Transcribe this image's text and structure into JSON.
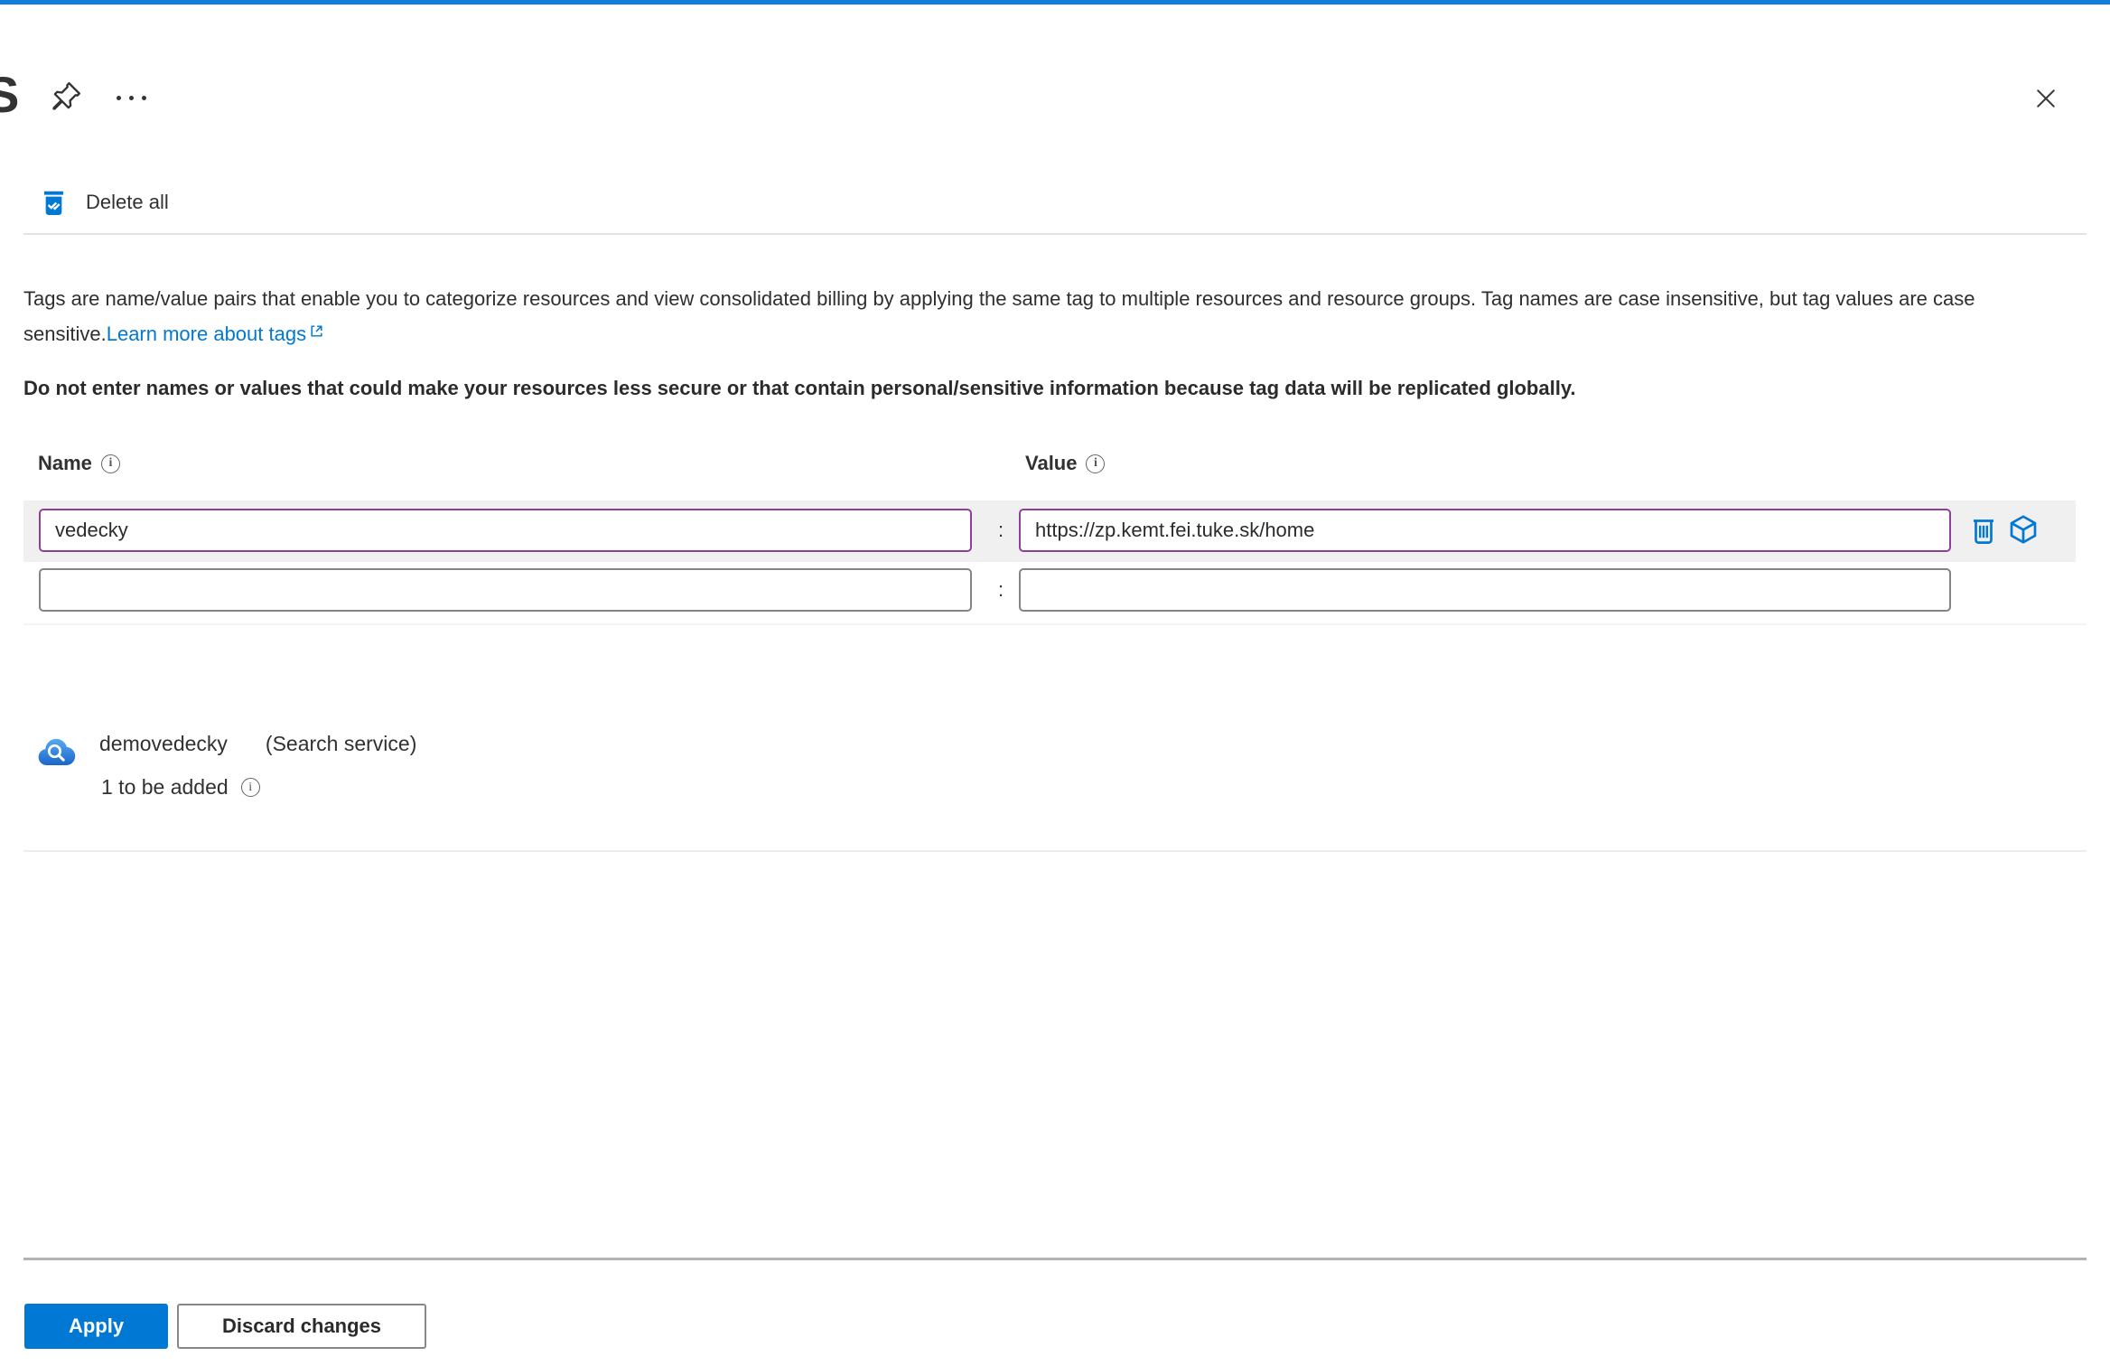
{
  "header": {
    "title_partial": "S",
    "separator_colon": ":"
  },
  "toolbar": {
    "delete_all_label": "Delete all"
  },
  "description": {
    "text": "Tags are name/value pairs that enable you to categorize resources and view consolidated billing by applying the same tag to multiple resources and resource groups. Tag names are case insensitive, but tag values are case sensitive.",
    "link_label": "Learn more about tags",
    "warning": "Do not enter names or values that could make your resources less secure or that contain personal/sensitive information because tag data will be replicated globally."
  },
  "tags_table": {
    "name_header": "Name",
    "value_header": "Value",
    "rows": [
      {
        "name": "vedecky",
        "value": "https://zp.kemt.fei.tuke.sk/home",
        "modified": true
      },
      {
        "name": "",
        "value": "",
        "modified": false
      }
    ]
  },
  "resource": {
    "name": "demovedecky",
    "type": "(Search service)",
    "status": "1 to be added"
  },
  "footer": {
    "apply_label": "Apply",
    "discard_label": "Discard changes"
  },
  "colors": {
    "accent_blue": "#0078d4",
    "modified_purple": "#8f3f98",
    "top_bar_blue": "#0f7fd9"
  }
}
